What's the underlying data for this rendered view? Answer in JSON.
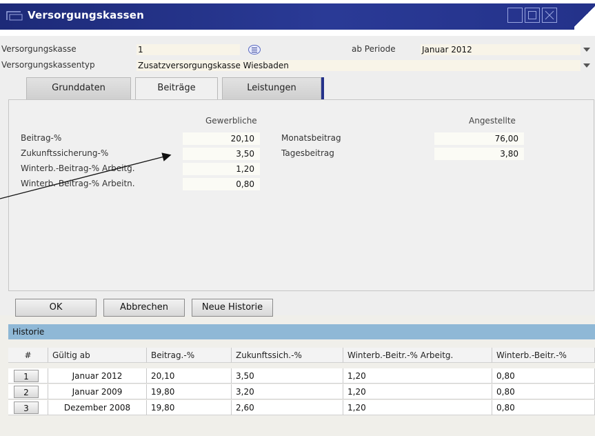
{
  "window": {
    "title": "Versorgungskassen",
    "controls": [
      "minimize-icon",
      "maximize-icon",
      "close-icon"
    ],
    "accent": "#24328a"
  },
  "header": {
    "versorgungskasse_label": "Versorgungskasse",
    "versorgungskasse_value": "1",
    "periode_label": "ab Periode",
    "periode_value": "Januar 2012",
    "typ_label": "Versorgungskassentyp",
    "typ_value": "Zusatzversorgungskasse Wiesbaden"
  },
  "tabs": [
    {
      "label": "Grunddaten",
      "selected": false
    },
    {
      "label": "Beiträge",
      "selected": true
    },
    {
      "label": "Leistungen",
      "selected": false
    }
  ],
  "beitraege": {
    "gewerbliche_header": "Gewerbliche",
    "angestellte_header": "Angestellte",
    "gewerbliche": [
      {
        "label": "Beitrag-%",
        "value": "20,10"
      },
      {
        "label": "Zukunftssicherung-%",
        "value": "3,50"
      },
      {
        "label": "Winterb.-Beitrag-% Arbeitg.",
        "value": "1,20"
      },
      {
        "label": "Winterb.-Beitrag-% Arbeitn.",
        "value": "0,80"
      }
    ],
    "angestellte": [
      {
        "label": "Monatsbeitrag",
        "value": "76,00"
      },
      {
        "label": "Tagesbeitrag",
        "value": "3,80"
      }
    ]
  },
  "buttons": {
    "ok": "OK",
    "abbrechen": "Abbrechen",
    "neue_historie": "Neue Historie"
  },
  "historie": {
    "title": "Historie",
    "columns": [
      "#",
      "Gültig ab",
      "Beitrag.-%",
      "Zukunftssich.-%",
      "Winterb.-Beitr.-% Arbeitg.",
      "Winterb.-Beitr.-%"
    ],
    "rows": [
      {
        "num": "1",
        "gueltig_ab": "Januar 2012",
        "beitrag": "20,10",
        "zukunft": "3,50",
        "winterb_ag": "1,20",
        "winterb_an": "0,80"
      },
      {
        "num": "2",
        "gueltig_ab": "Januar 2009",
        "beitrag": "19,80",
        "zukunft": "3,20",
        "winterb_ag": "1,20",
        "winterb_an": "0,80"
      },
      {
        "num": "3",
        "gueltig_ab": "Dezember 2008",
        "beitrag": "19,80",
        "zukunft": "2,60",
        "winterb_ag": "1,20",
        "winterb_an": "0,80"
      }
    ]
  }
}
